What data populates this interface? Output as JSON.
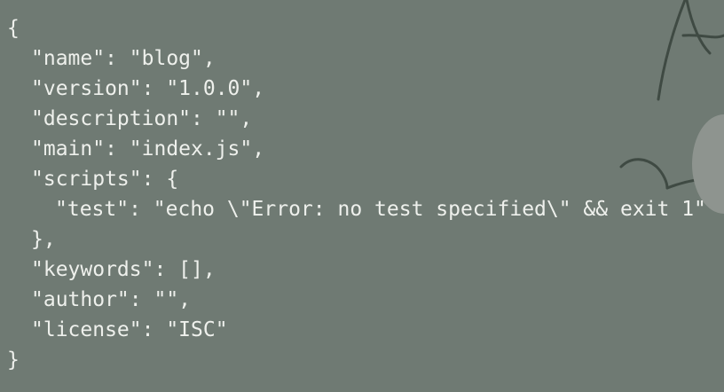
{
  "terminal": {
    "lines": [
      "{",
      "\"name\": \"blog\",",
      "\"version\": \"1.0.0\",",
      "\"description\": \"\",",
      "\"main\": \"index.js\",",
      "\"scripts\": {",
      "\"test\": \"echo \\\"Error: no test specified\\\" && exit 1\"",
      "},",
      "\"keywords\": [],",
      "\"author\": \"\",",
      "\"license\": \"ISC\"",
      "}"
    ]
  },
  "colors": {
    "background": "#6f7a73",
    "text": "#eef0ec"
  }
}
